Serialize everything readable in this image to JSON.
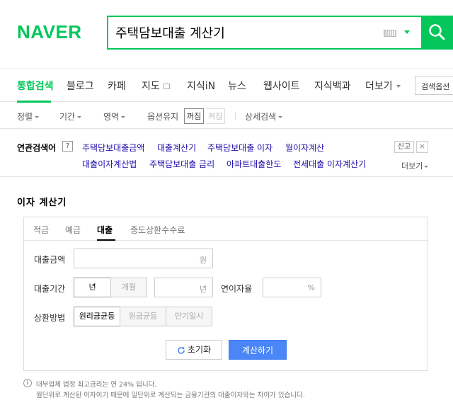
{
  "header": {
    "logo": "NAVER",
    "query": "주택담보대출 계산기"
  },
  "tabs": [
    {
      "label": "통합검색",
      "active": true
    },
    {
      "label": "블로그"
    },
    {
      "label": "카페"
    },
    {
      "label": "지도"
    },
    {
      "label": "지식iN"
    },
    {
      "label": "뉴스"
    },
    {
      "label": "웹사이트"
    },
    {
      "label": "지식백과"
    },
    {
      "label": "더보기"
    }
  ],
  "search_options_label": "검색옵션",
  "filters": {
    "sort": "정렬",
    "period": "기간",
    "area": "영역",
    "option_keep": "옵션유지",
    "on": "꺼짐",
    "off": "켜짐",
    "detail": "상세검색"
  },
  "related": {
    "title": "연관검색어",
    "help": "?",
    "links": [
      "주택담보대출금액",
      "대출계산기",
      "주택담보대출 이자",
      "월이자계산",
      "대출이자계산법",
      "주택담보대출 금리",
      "아파트대출한도",
      "전세대출 이자계산기"
    ],
    "report": "신고",
    "more": "더보기"
  },
  "calculator": {
    "title": "이자 계산기",
    "tabs": [
      "적금",
      "예금",
      "대출",
      "중도상환수수료"
    ],
    "active_tab": "대출",
    "amount_label": "대출금액",
    "amount_unit": "원",
    "period_label": "대출기간",
    "period_year": "년",
    "period_month": "개월",
    "period_unit": "년",
    "rate_label": "연이자율",
    "rate_unit": "%",
    "repay_label": "상환방법",
    "repay_options": [
      "원리금균등",
      "원금균등",
      "만기일시"
    ],
    "reset_label": "초기화",
    "calc_label": "계산하기"
  },
  "notes": [
    "대부업체 법정 최고금리는 연 24% 입니다.",
    "월단위로 계산된 이자이기 때문에 일단위로 계산되는 금융기관의 대출이자와는 차이가 있습니다."
  ],
  "colors": {
    "brand": "#03c75a",
    "link": "#1a0dab",
    "primary_button": "#4a86f7"
  }
}
